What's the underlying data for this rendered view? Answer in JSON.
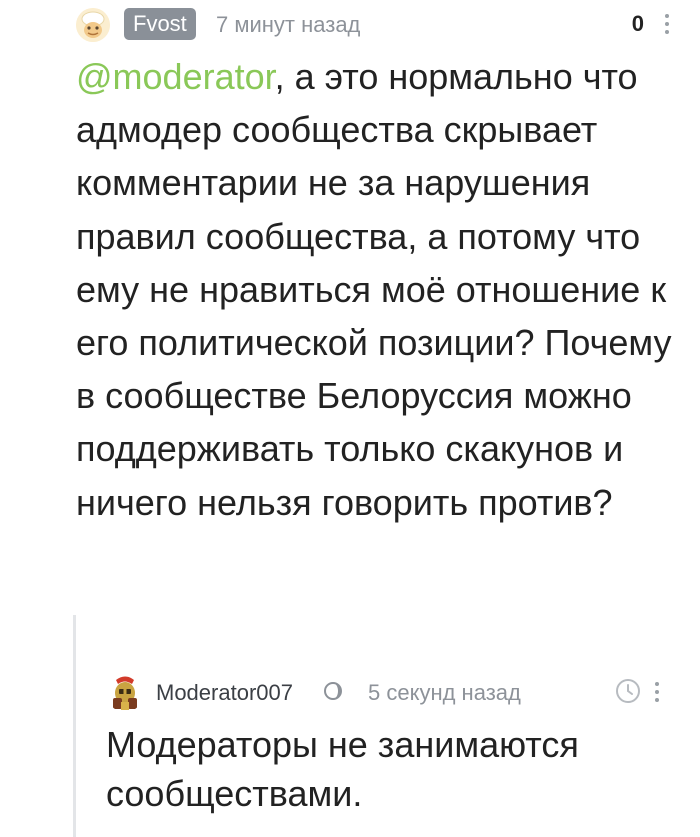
{
  "comment": {
    "author": "Fvost",
    "time": "7 минут назад",
    "rating": "0",
    "mention": "@moderator",
    "body": ", а это нормально что адмодер сообщества скрывает комментарии не за нарушения правил сообщества, а потому что ему не нравиться моё отношение к его политической позиции? Почему в сообществе Белоруссия можно поддерживать только скакунов и ничего нельзя говорить против?",
    "avatar_icon": "cartoon-face-avatar"
  },
  "reply": {
    "author": "Moderator007",
    "time": "5 секунд назад",
    "body": "Модераторы не занимаются сообществами.",
    "avatar_icon": "spartan-helmet-avatar",
    "status_icon": "moon-icon",
    "timer_icon": "clock-icon"
  },
  "colors": {
    "mention": "#8ac858",
    "author_badge": "#8a9098",
    "meta_text": "#8d9299",
    "thread_line": "#e3e5e8"
  }
}
